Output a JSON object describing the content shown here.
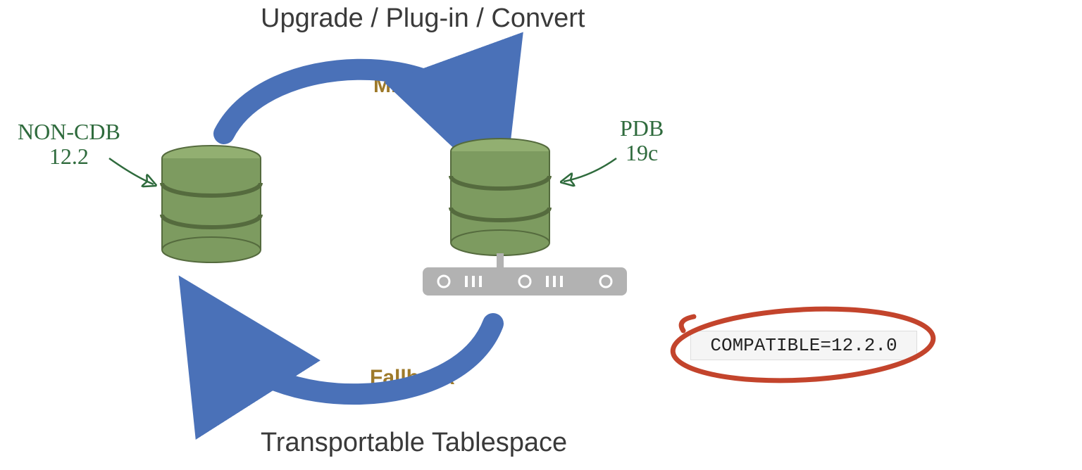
{
  "heading_top": "Upgrade / Plug-in / Convert",
  "heading_bottom": "Transportable Tablespace",
  "arrow_labels": {
    "migrate": "Migrate",
    "fallback": "Fallback"
  },
  "source": {
    "name": "NON-CDB",
    "version": "12.2"
  },
  "target": {
    "name": "PDB",
    "version": "19c"
  },
  "callout": {
    "text": "COMPATIBLE=12.2.0"
  },
  "colors": {
    "arrow_blue": "#4a71b8",
    "text_dark": "#3a3a3a",
    "accent_gold": "#9e7a2a",
    "hand_green": "#2f6b3d",
    "db_light": "#92af71",
    "db_dark": "#556b3e",
    "server_gray": "#b2b2b2",
    "circle_red": "#c3442c"
  },
  "chart_data": {
    "type": "diagram",
    "nodes": [
      {
        "id": "source",
        "label": "NON-CDB 12.2",
        "icon": "database"
      },
      {
        "id": "target",
        "label": "PDB 19c",
        "icon": "database-on-server"
      }
    ],
    "edges": [
      {
        "from": "source",
        "to": "target",
        "label": "Migrate",
        "title": "Upgrade / Plug-in / Convert"
      },
      {
        "from": "target",
        "to": "source",
        "label": "Fallback",
        "title": "Transportable Tablespace"
      }
    ],
    "annotations": [
      {
        "text": "COMPATIBLE=12.2.0",
        "style": "callout-circled",
        "attached_to": "target"
      }
    ]
  }
}
